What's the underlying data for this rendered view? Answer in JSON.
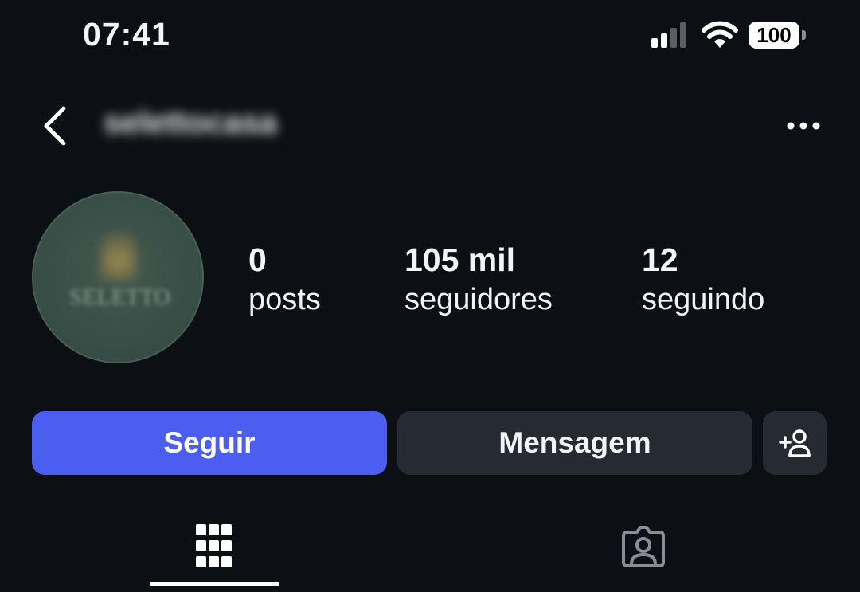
{
  "status_bar": {
    "time": "07:41",
    "battery": "100",
    "icons": [
      "cellular-signal-icon",
      "wifi-icon",
      "battery-icon"
    ]
  },
  "header": {
    "username": "selettocasa",
    "back_icon": "chevron-left-icon",
    "more_icon": "more-horizontal-icon"
  },
  "profile": {
    "avatar_brand_text": "SELETTO",
    "stats": {
      "posts": {
        "value": "0",
        "label": "posts"
      },
      "followers": {
        "value": "105 mil",
        "label": "seguidores"
      },
      "following": {
        "value": "12",
        "label": "seguindo"
      }
    }
  },
  "actions": {
    "follow_label": "Seguir",
    "message_label": "Mensagem",
    "add_user_icon": "add-person-icon"
  },
  "tabs": [
    {
      "name": "posts-grid",
      "icon": "grid-icon",
      "active": true
    },
    {
      "name": "tagged",
      "icon": "tagged-person-icon",
      "active": false
    }
  ],
  "colors": {
    "background": "#0c0f14",
    "primary_button": "#4b5ef0",
    "secondary_button": "#262a31",
    "text": "#f2f4f7"
  }
}
